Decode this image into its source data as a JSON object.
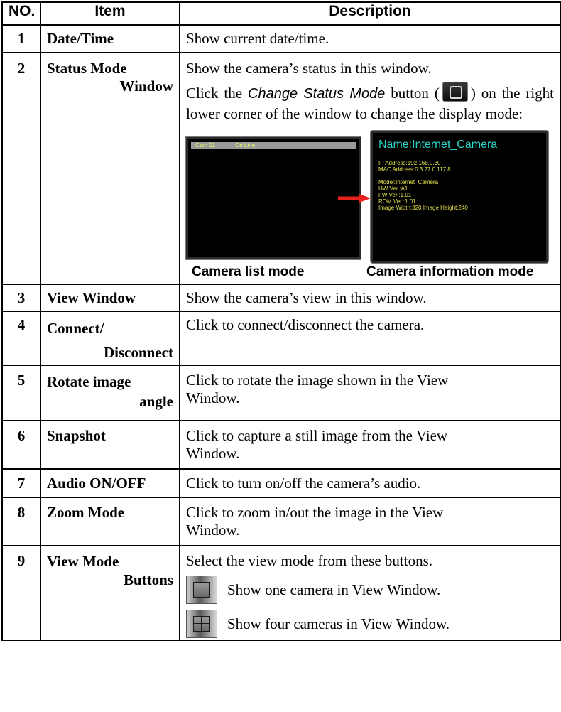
{
  "table": {
    "headers": {
      "no": "NO.",
      "item": "Item",
      "description": "Description"
    },
    "rows": [
      {
        "no": "1",
        "item": [
          "Date/Time"
        ],
        "desc": [
          "Show current date/time."
        ]
      },
      {
        "no": "2",
        "item": [
          "Status Mode",
          "Window"
        ],
        "desc_intro": "Show the camera’s status in this window.",
        "desc_click_pre": "Click the ",
        "desc_click_italic": "Change Status Mode",
        "desc_click_mid": " button (",
        "desc_click_post": ") on the right lower corner of the window to change the display mode:",
        "screens": {
          "list": {
            "col1": "Cam 01",
            "col2": "On Line"
          },
          "info": {
            "title": "Name:Internet_Camera",
            "line1": "IP Address:192.168.0.30",
            "line2": "MAC Address:0.3.27.0.117.8",
            "line3": "Model:Internet_Camera",
            "line4": "HW Ver.:A1 !",
            "line5": "FW Ver.:1.01",
            "line6": "ROM Ver.:1.01",
            "line7": "Image Width:320   Image Height:240"
          },
          "caption_list": "Camera list mode",
          "caption_info": "Camera information mode"
        }
      },
      {
        "no": "3",
        "item": [
          "View Window"
        ],
        "desc": [
          "Show the camera’s view in this window."
        ]
      },
      {
        "no": "4",
        "item": [
          "Connect/",
          "Disconnect"
        ],
        "desc": [
          "Click to connect/disconnect the camera."
        ]
      },
      {
        "no": "5",
        "item": [
          "Rotate image",
          "angle"
        ],
        "desc": [
          "Click to rotate the image shown in the View",
          "Window."
        ]
      },
      {
        "no": "6",
        "item": [
          "Snapshot"
        ],
        "desc": [
          "Click to capture a still image from the View",
          "Window."
        ]
      },
      {
        "no": "7",
        "item": [
          "Audio ON/OFF"
        ],
        "desc": [
          "Click to turn on/off the camera’s audio."
        ]
      },
      {
        "no": "8",
        "item": [
          "Zoom Mode"
        ],
        "desc": [
          "Click to zoom in/out the image in the View",
          "Window."
        ]
      },
      {
        "no": "9",
        "item": [
          "View Mode",
          "Buttons"
        ],
        "desc_intro": "Select the view mode from these buttons.",
        "buttons": [
          {
            "icon": "single-view-icon",
            "text": "Show one camera in View Window."
          },
          {
            "icon": "quad-view-icon",
            "text": "Show four cameras in View Window."
          }
        ]
      }
    ]
  },
  "colors": {
    "info_title": "#2ad5c7",
    "info_text": "#e3e34a",
    "list_text": "#e8ff66",
    "arrow": "#e8201c"
  }
}
